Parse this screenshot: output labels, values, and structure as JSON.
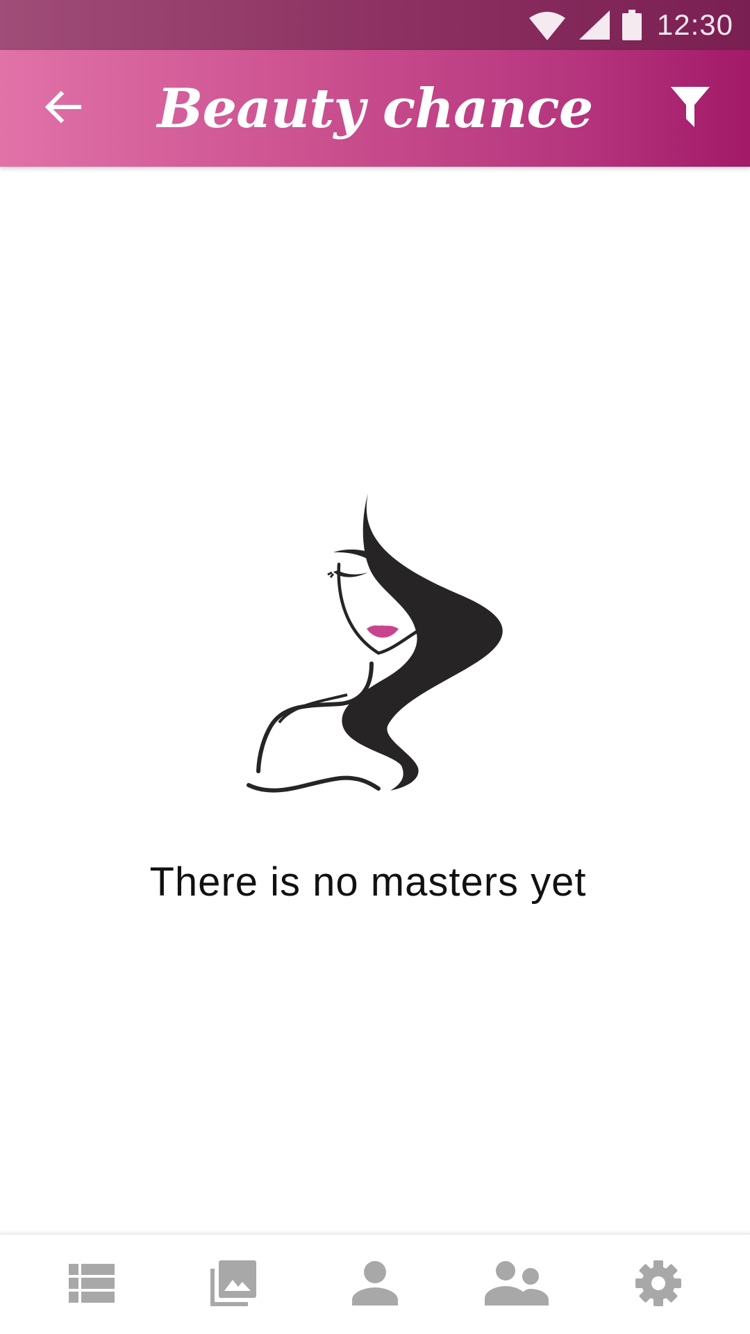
{
  "status_bar": {
    "time": "12:30",
    "icons": [
      "wifi-icon",
      "signal-icon",
      "battery-icon"
    ]
  },
  "app_bar": {
    "title": "Beauty chance",
    "back_icon": "arrow-back-icon",
    "filter_icon": "filter-icon"
  },
  "empty_state": {
    "illustration": "woman-silhouette-logo",
    "message": "There is no masters yet"
  },
  "bottom_nav": {
    "items": [
      {
        "icon": "list-icon"
      },
      {
        "icon": "gallery-icon"
      },
      {
        "icon": "person-icon"
      },
      {
        "icon": "people-icon"
      },
      {
        "icon": "settings-gear-icon"
      }
    ]
  },
  "colors": {
    "status_bar": "#8d3262",
    "app_bar_start": "#e172a8",
    "app_bar_end": "#a21a68",
    "nav_icon": "#a8a8a8",
    "lips": "#c8448f"
  }
}
